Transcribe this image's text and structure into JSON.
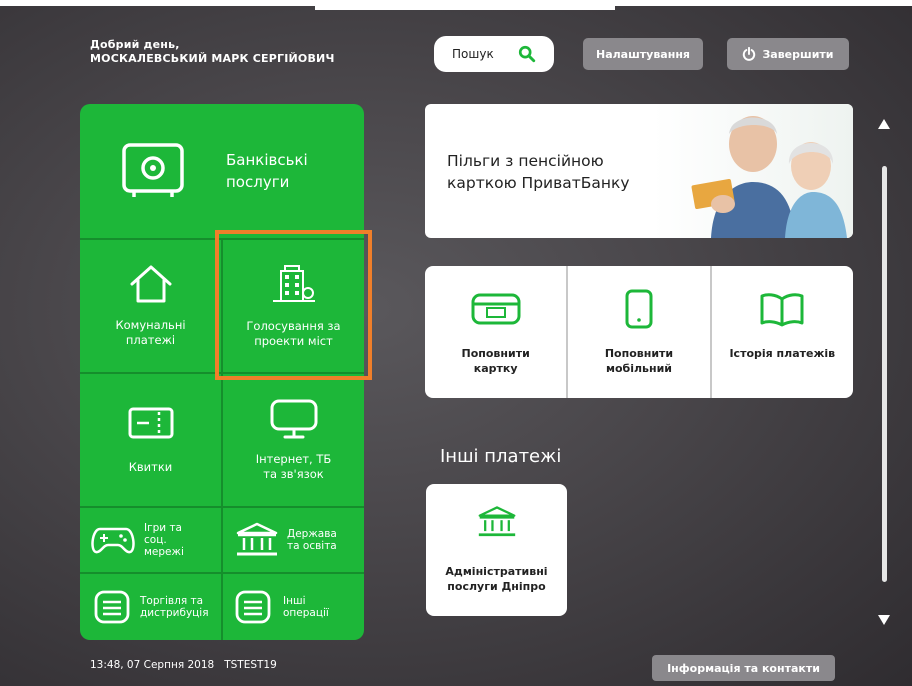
{
  "header": {
    "greeting_line1": "Добрий день,",
    "greeting_line2": "МОСКАЛЕВСЬКИЙ МАРК СЕРГІЙОВИЧ",
    "search_label": "Пошук",
    "settings_label": "Налаштування",
    "exit_label": "Завершити"
  },
  "menu": {
    "bank": {
      "line1": "Банківські",
      "line2": "послуги",
      "icon": "safe-icon"
    },
    "utilities": {
      "line1": "Комунальні",
      "line2": "платежі",
      "icon": "house-icon"
    },
    "voting": {
      "line1": "Голосування за",
      "line2": "проекти міст",
      "icon": "city-building-icon"
    },
    "tickets": {
      "line1": "Квитки",
      "icon": "ticket-icon"
    },
    "internet": {
      "line1": "Інтернет, ТБ",
      "line2": "та зв'язок",
      "icon": "monitor-icon"
    },
    "games": {
      "line1": "Ігри та",
      "line2": "соц.",
      "line3": "мережі",
      "icon": "gamepad-icon"
    },
    "state": {
      "line1": "Держава",
      "line2": "та освіта",
      "icon": "government-building-icon"
    },
    "trade": {
      "line1": "Торгівля та",
      "line2": "дистрибуція",
      "icon": "list-icon"
    },
    "other": {
      "line1": "Інші",
      "line2": "операції",
      "icon": "list-icon"
    }
  },
  "banner": {
    "line1": "Пільги з пенсійною",
    "line2": "карткою ПриватБанку"
  },
  "quick_actions": [
    {
      "line1": "Поповнити",
      "line2": "картку",
      "icon": "card-icon"
    },
    {
      "line1": "Поповнити",
      "line2": "мобільний",
      "icon": "phone-icon"
    },
    {
      "line1": "Історія платежів",
      "line2": "",
      "icon": "book-icon"
    }
  ],
  "other_payments": {
    "title": "Інші платежі",
    "admin_line1": "Адміністративні",
    "admin_line2": "послуги Дніпро",
    "admin_icon": "government-building-icon"
  },
  "footer": {
    "status": "13:48, 07 Серпня 2018   TSTEST19",
    "info_label": "Інформація та контакти"
  },
  "colors": {
    "green": "#1db739",
    "highlight": "#f07f2a",
    "button_gray": "#8a888c"
  }
}
